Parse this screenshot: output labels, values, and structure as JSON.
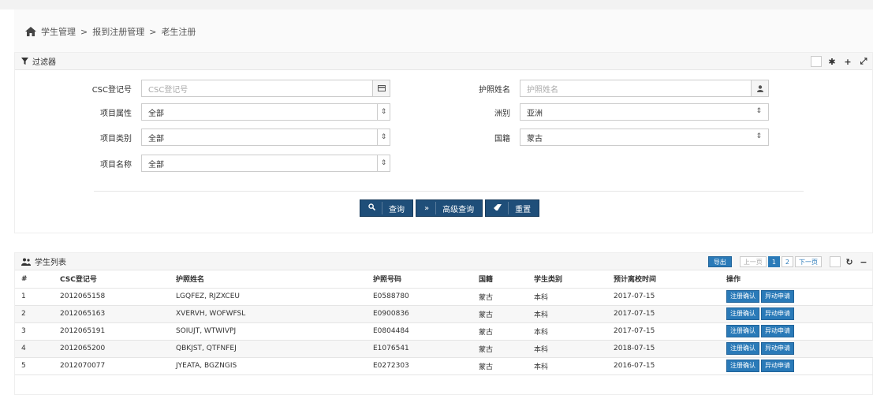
{
  "breadcrumb": {
    "items": [
      "学生管理",
      "报到注册管理",
      "老生注册"
    ],
    "separator": ">"
  },
  "filter_panel": {
    "title": "过滤器",
    "fields": {
      "csc_label": "CSC登记号",
      "csc_placeholder": "CSC登记号",
      "passport_name_label": "护照姓名",
      "passport_name_placeholder": "护照姓名",
      "project_attr_label": "项目属性",
      "project_attr_value": "全部",
      "continent_label": "洲别",
      "continent_value": "亚洲",
      "project_type_label": "项目类别",
      "project_type_value": "全部",
      "nationality_label": "国籍",
      "nationality_value": "蒙古",
      "project_name_label": "项目名称",
      "project_name_value": "全部"
    },
    "buttons": {
      "query": "查询",
      "advanced_query": "高级查询",
      "reset": "重置"
    }
  },
  "list_panel": {
    "title": "学生列表",
    "export_label": "导出",
    "pager": {
      "prev": "上一页",
      "pages": [
        "1",
        "2"
      ],
      "next": "下一页",
      "current": "1"
    },
    "columns": [
      "#",
      "CSC登记号",
      "护照姓名",
      "护照号码",
      "国籍",
      "学生类别",
      "预计离校时间",
      "操作"
    ],
    "rows": [
      {
        "no": "1",
        "csc": "2012065158",
        "name": "LGQFEZ, RJZXCEU",
        "passport": "E0588780",
        "nation": "蒙古",
        "type": "本科",
        "leave": "2017-07-15"
      },
      {
        "no": "2",
        "csc": "2012065163",
        "name": "XVERVH, WOFWFSL",
        "passport": "E0900836",
        "nation": "蒙古",
        "type": "本科",
        "leave": "2017-07-15"
      },
      {
        "no": "3",
        "csc": "2012065191",
        "name": "SOIUJT, WTWIVPJ",
        "passport": "E0804484",
        "nation": "蒙古",
        "type": "本科",
        "leave": "2017-07-15"
      },
      {
        "no": "4",
        "csc": "2012065200",
        "name": "QBKJST, QTFNFEJ",
        "passport": "E1076541",
        "nation": "蒙古",
        "type": "本科",
        "leave": "2018-07-15"
      },
      {
        "no": "5",
        "csc": "2012070077",
        "name": "JYEATA, BGZNGIS",
        "passport": "E0272303",
        "nation": "蒙古",
        "type": "本科",
        "leave": "2016-07-15"
      }
    ],
    "actions": {
      "confirm": "注册确认",
      "apply": "异动申请"
    }
  },
  "colors": {
    "primary_button": "#1f4e79",
    "action_button": "#2a7ab8"
  },
  "icons": {
    "home": "home-icon",
    "filter": "funnel-icon",
    "list": "users-icon"
  }
}
